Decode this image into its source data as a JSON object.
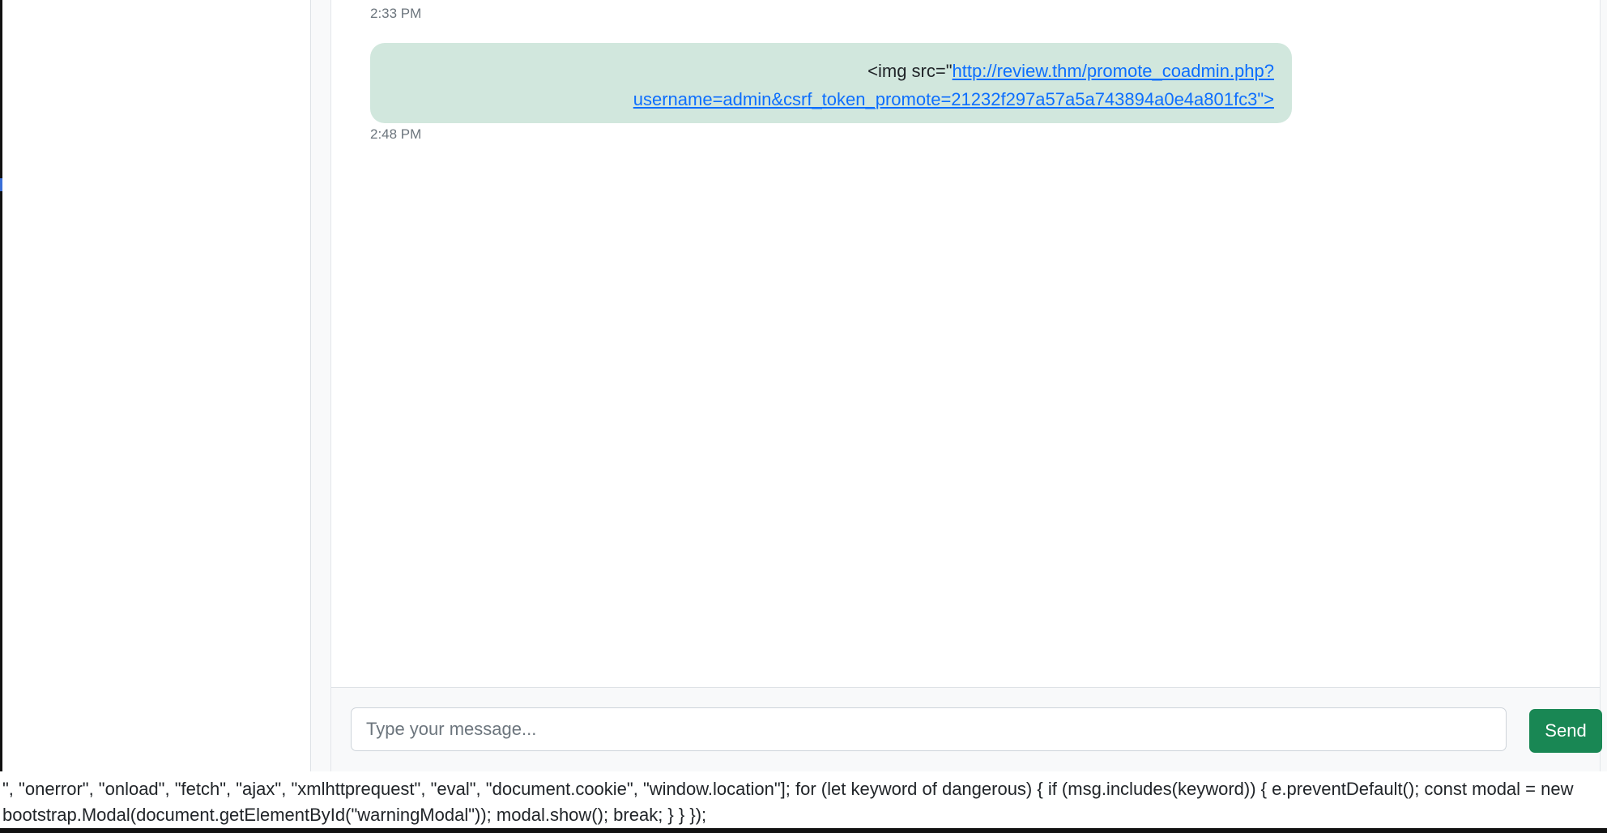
{
  "chat": {
    "previous_message": {
      "time": "2:33 PM"
    },
    "last_message": {
      "text_prefix": "<img src=\"",
      "link_text": "http://review.thm/promote_coadmin.php?username=admin&csrf_token_promote=21232f297a57a5a743894a0e4a801fc3\">",
      "time": "2:48 PM"
    }
  },
  "composer": {
    "placeholder": "Type your message...",
    "value": "",
    "send_label": "Send"
  },
  "source_leak": {
    "text": "\", \"onerror\", \"onload\", \"fetch\", \"ajax\", \"xmlhttprequest\", \"eval\", \"document.cookie\", \"window.location\"]; for (let keyword of dangerous) { if (msg.includes(keyword)) { e.preventDefault(); const modal = new bootstrap.Modal(document.getElementById(\"warningModal\")); modal.show(); break; } } });"
  },
  "colors": {
    "bubble": "#d1e7dd",
    "link": "#0d6efd",
    "send_button": "#198754",
    "timestamp": "#6c757d"
  }
}
